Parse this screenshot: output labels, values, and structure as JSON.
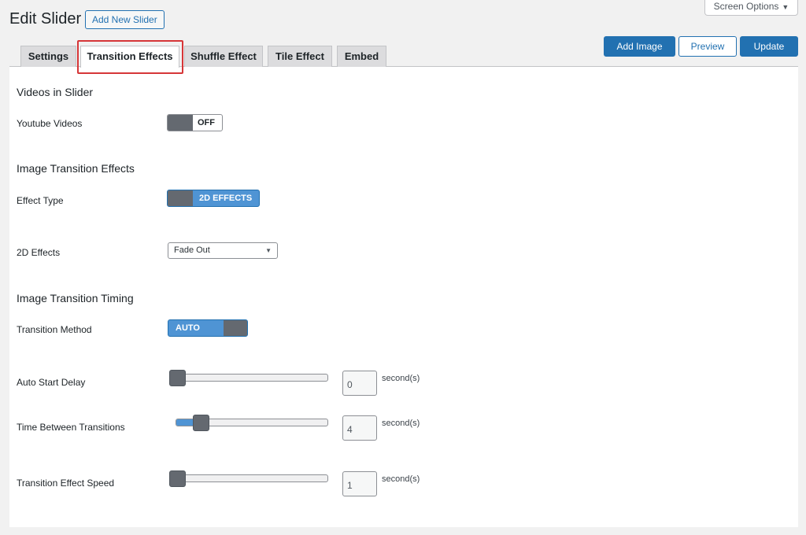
{
  "header": {
    "title": "Edit Slider",
    "add_new_label": "Add New Slider",
    "screen_options_label": "Screen Options"
  },
  "actions": {
    "add_image": "Add Image",
    "preview": "Preview",
    "update": "Update"
  },
  "tabs": [
    {
      "label": "Settings"
    },
    {
      "label": "Transition Effects"
    },
    {
      "label": "Shuffle Effect"
    },
    {
      "label": "Tile Effect"
    },
    {
      "label": "Embed"
    }
  ],
  "active_tab": "Transition Effects",
  "sections": {
    "videos": {
      "title": "Videos in Slider",
      "youtube_label": "Youtube Videos",
      "youtube_state": "OFF"
    },
    "effects": {
      "title": "Image Transition Effects",
      "effect_type_label": "Effect Type",
      "effect_type_value": "2D EFFECTS",
      "effects_2d_label": "2D Effects",
      "effects_2d_value": "Fade Out"
    },
    "timing": {
      "title": "Image Transition Timing",
      "method_label": "Transition Method",
      "method_value": "AUTO",
      "auto_start_label": "Auto Start Delay",
      "auto_start_value": "0",
      "time_between_label": "Time Between Transitions",
      "time_between_value": "4",
      "speed_label": "Transition Effect Speed",
      "speed_value": "1",
      "unit": "second(s)"
    }
  },
  "colors": {
    "accent": "#2271b1",
    "highlight": "#d63638",
    "toggle_on": "#4f94d4",
    "knob": "#646970"
  }
}
